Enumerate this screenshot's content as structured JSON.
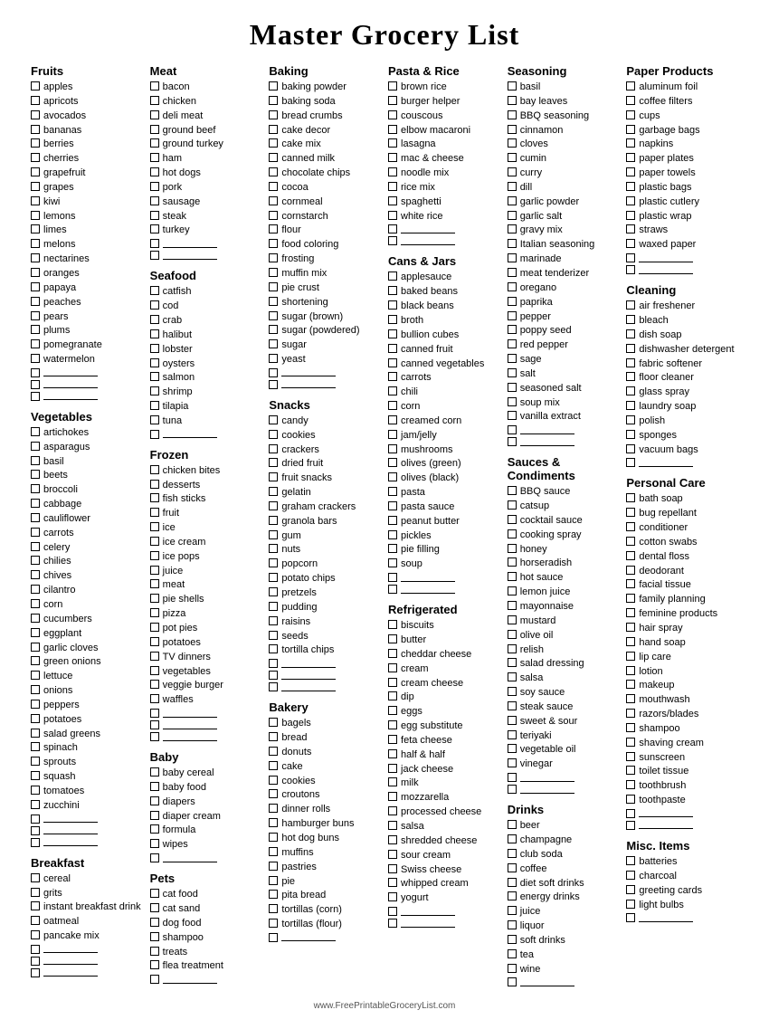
{
  "title": "Master Grocery List",
  "footer": "www.FreePrintableGroceryList.com",
  "columns": [
    {
      "sections": [
        {
          "title": "Fruits",
          "items": [
            "apples",
            "apricots",
            "avocados",
            "bananas",
            "berries",
            "cherries",
            "grapefruit",
            "grapes",
            "kiwi",
            "lemons",
            "limes",
            "melons",
            "nectarines",
            "oranges",
            "papaya",
            "peaches",
            "pears",
            "plums",
            "pomegranate",
            "watermelon"
          ],
          "blanks": 3
        },
        {
          "title": "Vegetables",
          "items": [
            "artichokes",
            "asparagus",
            "basil",
            "beets",
            "broccoli",
            "cabbage",
            "cauliflower",
            "carrots",
            "celery",
            "chilies",
            "chives",
            "cilantro",
            "corn",
            "cucumbers",
            "eggplant",
            "garlic cloves",
            "green onions",
            "lettuce",
            "onions",
            "peppers",
            "potatoes",
            "salad greens",
            "spinach",
            "sprouts",
            "squash",
            "tomatoes",
            "zucchini"
          ],
          "blanks": 3
        },
        {
          "title": "Breakfast",
          "items": [
            "cereal",
            "grits",
            "instant breakfast drink",
            "oatmeal",
            "pancake mix"
          ],
          "blanks": 3
        }
      ]
    },
    {
      "sections": [
        {
          "title": "Meat",
          "items": [
            "bacon",
            "chicken",
            "deli meat",
            "ground beef",
            "ground turkey",
            "ham",
            "hot dogs",
            "pork",
            "sausage",
            "steak",
            "turkey"
          ],
          "blanks": 2
        },
        {
          "title": "Seafood",
          "items": [
            "catfish",
            "cod",
            "crab",
            "halibut",
            "lobster",
            "oysters",
            "salmon",
            "shrimp",
            "tilapia",
            "tuna"
          ],
          "blanks": 1
        },
        {
          "title": "Frozen",
          "items": [
            "chicken bites",
            "desserts",
            "fish sticks",
            "fruit",
            "ice",
            "ice cream",
            "ice pops",
            "juice",
            "meat",
            "pie shells",
            "pizza",
            "pot pies",
            "potatoes",
            "TV dinners",
            "vegetables",
            "veggie burger",
            "waffles"
          ],
          "blanks": 3
        },
        {
          "title": "Baby",
          "items": [
            "baby cereal",
            "baby food",
            "diapers",
            "diaper cream",
            "formula",
            "wipes"
          ],
          "blanks": 1
        },
        {
          "title": "Pets",
          "items": [
            "cat food",
            "cat sand",
            "dog food",
            "shampoo",
            "treats",
            "flea treatment"
          ],
          "blanks": 1
        }
      ]
    },
    {
      "sections": [
        {
          "title": "Baking",
          "items": [
            "baking powder",
            "baking soda",
            "bread crumbs",
            "cake decor",
            "cake mix",
            "canned milk",
            "chocolate chips",
            "cocoa",
            "cornmeal",
            "cornstarch",
            "flour",
            "food coloring",
            "frosting",
            "muffin mix",
            "pie crust",
            "shortening",
            "sugar (brown)",
            "sugar (powdered)",
            "sugar",
            "yeast"
          ],
          "blanks": 2
        },
        {
          "title": "Snacks",
          "items": [
            "candy",
            "cookies",
            "crackers",
            "dried fruit",
            "fruit snacks",
            "gelatin",
            "graham crackers",
            "granola bars",
            "gum",
            "nuts",
            "popcorn",
            "potato chips",
            "pretzels",
            "pudding",
            "raisins",
            "seeds",
            "tortilla chips"
          ],
          "blanks": 3
        },
        {
          "title": "Bakery",
          "items": [
            "bagels",
            "bread",
            "donuts",
            "cake",
            "cookies",
            "croutons",
            "dinner rolls",
            "hamburger buns",
            "hot dog buns",
            "muffins",
            "pastries",
            "pie",
            "pita bread",
            "tortillas (corn)",
            "tortillas (flour)"
          ],
          "blanks": 1
        }
      ]
    },
    {
      "sections": [
        {
          "title": "Pasta & Rice",
          "items": [
            "brown rice",
            "burger helper",
            "couscous",
            "elbow macaroni",
            "lasagna",
            "mac & cheese",
            "noodle mix",
            "rice mix",
            "spaghetti",
            "white rice"
          ],
          "blanks": 2
        },
        {
          "title": "Cans & Jars",
          "items": [
            "applesauce",
            "baked beans",
            "black beans",
            "broth",
            "bullion cubes",
            "canned fruit",
            "canned vegetables",
            "carrots",
            "chili",
            "corn",
            "creamed corn",
            "jam/jelly",
            "mushrooms",
            "olives (green)",
            "olives (black)",
            "pasta",
            "pasta sauce",
            "peanut butter",
            "pickles",
            "pie filling",
            "soup"
          ],
          "blanks": 2
        },
        {
          "title": "Refrigerated",
          "items": [
            "biscuits",
            "butter",
            "cheddar cheese",
            "cream",
            "cream cheese",
            "dip",
            "eggs",
            "egg substitute",
            "feta cheese",
            "half & half",
            "jack cheese",
            "milk",
            "mozzarella",
            "processed cheese",
            "salsa",
            "shredded cheese",
            "sour cream",
            "Swiss cheese",
            "whipped cream",
            "yogurt"
          ],
          "blanks": 2
        }
      ]
    },
    {
      "sections": [
        {
          "title": "Seasoning",
          "items": [
            "basil",
            "bay leaves",
            "BBQ seasoning",
            "cinnamon",
            "cloves",
            "cumin",
            "curry",
            "dill",
            "garlic powder",
            "garlic salt",
            "gravy mix",
            "Italian seasoning",
            "marinade",
            "meat tenderizer",
            "oregano",
            "paprika",
            "pepper",
            "poppy seed",
            "red pepper",
            "sage",
            "salt",
            "seasoned salt",
            "soup mix",
            "vanilla extract"
          ],
          "blanks": 2
        },
        {
          "title": "Sauces & Condiments",
          "items": [
            "BBQ sauce",
            "catsup",
            "cocktail sauce",
            "cooking spray",
            "honey",
            "horseradish",
            "hot sauce",
            "lemon juice",
            "mayonnaise",
            "mustard",
            "olive oil",
            "relish",
            "salad dressing",
            "salsa",
            "soy sauce",
            "steak sauce",
            "sweet & sour",
            "teriyaki",
            "vegetable oil",
            "vinegar"
          ],
          "blanks": 2
        },
        {
          "title": "Drinks",
          "items": [
            "beer",
            "champagne",
            "club soda",
            "coffee",
            "diet soft drinks",
            "energy drinks",
            "juice",
            "liquor",
            "soft drinks",
            "tea",
            "wine"
          ],
          "blanks": 1
        }
      ]
    },
    {
      "sections": [
        {
          "title": "Paper Products",
          "items": [
            "aluminum foil",
            "coffee filters",
            "cups",
            "garbage bags",
            "napkins",
            "paper plates",
            "paper towels",
            "plastic bags",
            "plastic cutlery",
            "plastic wrap",
            "straws",
            "waxed paper"
          ],
          "blanks": 2
        },
        {
          "title": "Cleaning",
          "items": [
            "air freshener",
            "bleach",
            "dish soap",
            "dishwasher detergent",
            "fabric softener",
            "floor cleaner",
            "glass spray",
            "laundry soap",
            "polish",
            "sponges",
            "vacuum bags"
          ],
          "blanks": 1
        },
        {
          "title": "Personal Care",
          "items": [
            "bath soap",
            "bug repellant",
            "conditioner",
            "cotton swabs",
            "dental floss",
            "deodorant",
            "facial tissue",
            "family planning",
            "feminine products",
            "hair spray",
            "hand soap",
            "lip care",
            "lotion",
            "makeup",
            "mouthwash",
            "razors/blades",
            "shampoo",
            "shaving cream",
            "sunscreen",
            "toilet tissue",
            "toothbrush",
            "toothpaste"
          ],
          "blanks": 2
        },
        {
          "title": "Misc. Items",
          "items": [
            "batteries",
            "charcoal",
            "greeting cards",
            "light bulbs"
          ],
          "blanks": 1
        }
      ]
    }
  ]
}
